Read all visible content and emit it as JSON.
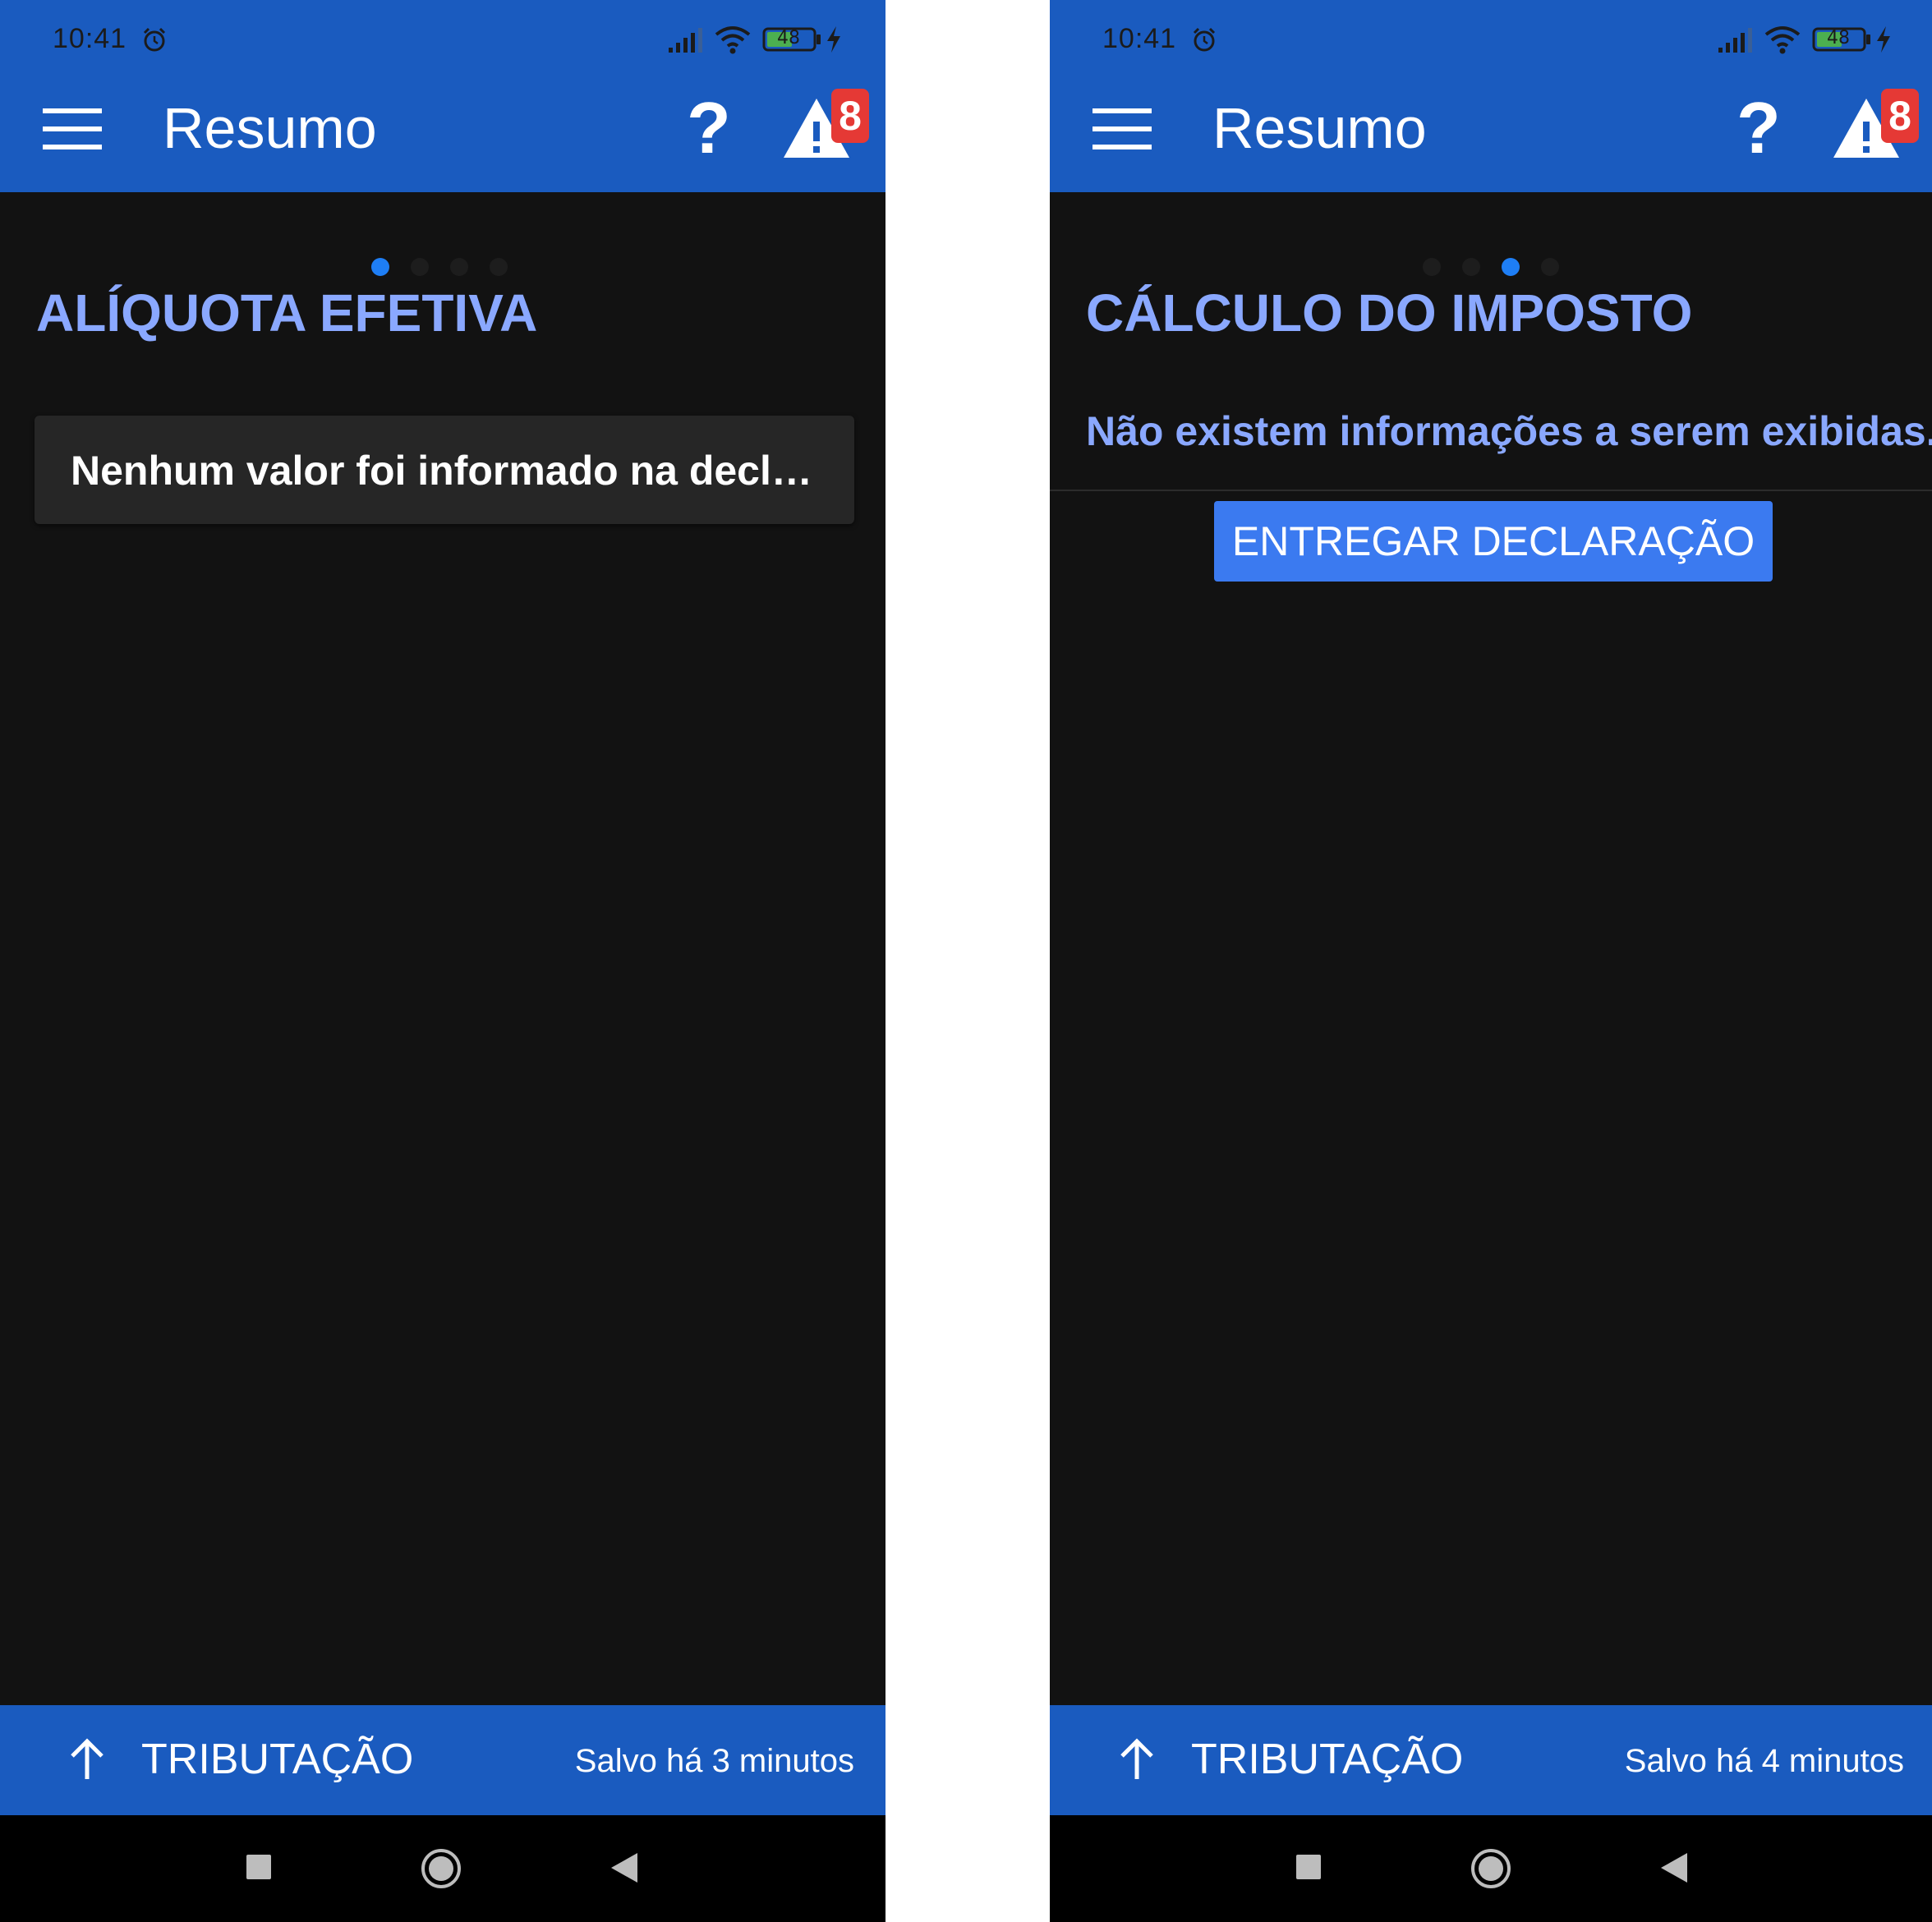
{
  "screens": [
    {
      "status": {
        "time": "10:41",
        "battery": "48"
      },
      "appbar": {
        "title": "Resumo",
        "help_symbol": "?",
        "warning_count": "8"
      },
      "page_indicator": {
        "total": 4,
        "active": 1
      },
      "section": {
        "title": "ALÍQUOTA EFETIVA",
        "empty_message": "Nenhum valor foi informado na declaração."
      },
      "bottom_bar": {
        "label": "TRIBUTAÇÃO",
        "saved_text": "Salvo há 3 minutos"
      }
    },
    {
      "status": {
        "time": "10:41",
        "battery": "48"
      },
      "appbar": {
        "title": "Resumo",
        "help_symbol": "?",
        "warning_count": "8"
      },
      "page_indicator": {
        "total": 4,
        "active": 3
      },
      "section": {
        "title": "CÁLCULO DO IMPOSTO",
        "empty_message": "Não existem informações a serem exibidas.",
        "action_label": "ENTREGAR DECLARAÇÃO"
      },
      "bottom_bar": {
        "label": "TRIBUTAÇÃO",
        "saved_text": "Salvo há 4 minutos"
      }
    }
  ],
  "colors": {
    "appbar": "#1a5bbf",
    "background": "#121212",
    "accent_text": "#8aa8ff",
    "active_dot": "#1e7ef5",
    "button": "#3b7af0",
    "badge": "#e53935"
  },
  "icons": {
    "menu": "menu-icon",
    "help": "help-icon",
    "warning": "warning-icon",
    "up": "arrow-up-icon",
    "nav_recent": "recent-apps-icon",
    "nav_home": "home-icon",
    "nav_back": "back-icon"
  }
}
